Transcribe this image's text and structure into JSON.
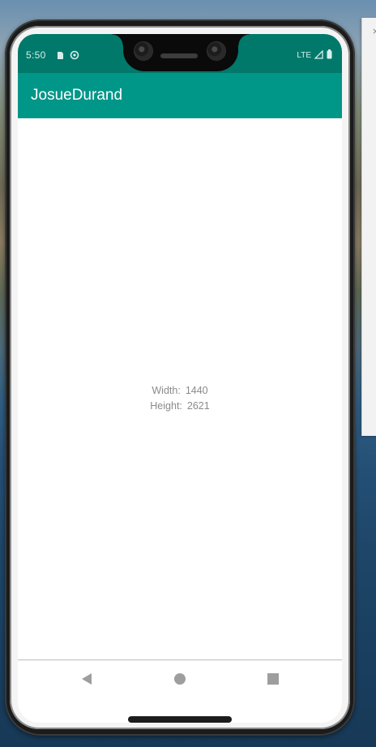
{
  "status_bar": {
    "time": "5:50",
    "network_label": "LTE",
    "left_icons": [
      "sim-card-icon",
      "sync-icon"
    ],
    "right_icons": [
      "signal-icon",
      "battery-icon"
    ]
  },
  "app_bar": {
    "title": "JosueDurand"
  },
  "content": {
    "width_label": "Width:",
    "width_value": "1440",
    "height_label": "Height:",
    "height_value": "2621"
  },
  "nav_bar": {
    "buttons": [
      "back-icon",
      "home-icon",
      "recents-icon"
    ]
  },
  "background_window": {
    "close_glyph": "×"
  },
  "colors": {
    "status_bar": "#00796b",
    "app_bar": "#009688",
    "content_background": "#ffffff",
    "content_text": "#8a8a8a",
    "nav_icons": "#9e9e9e"
  }
}
